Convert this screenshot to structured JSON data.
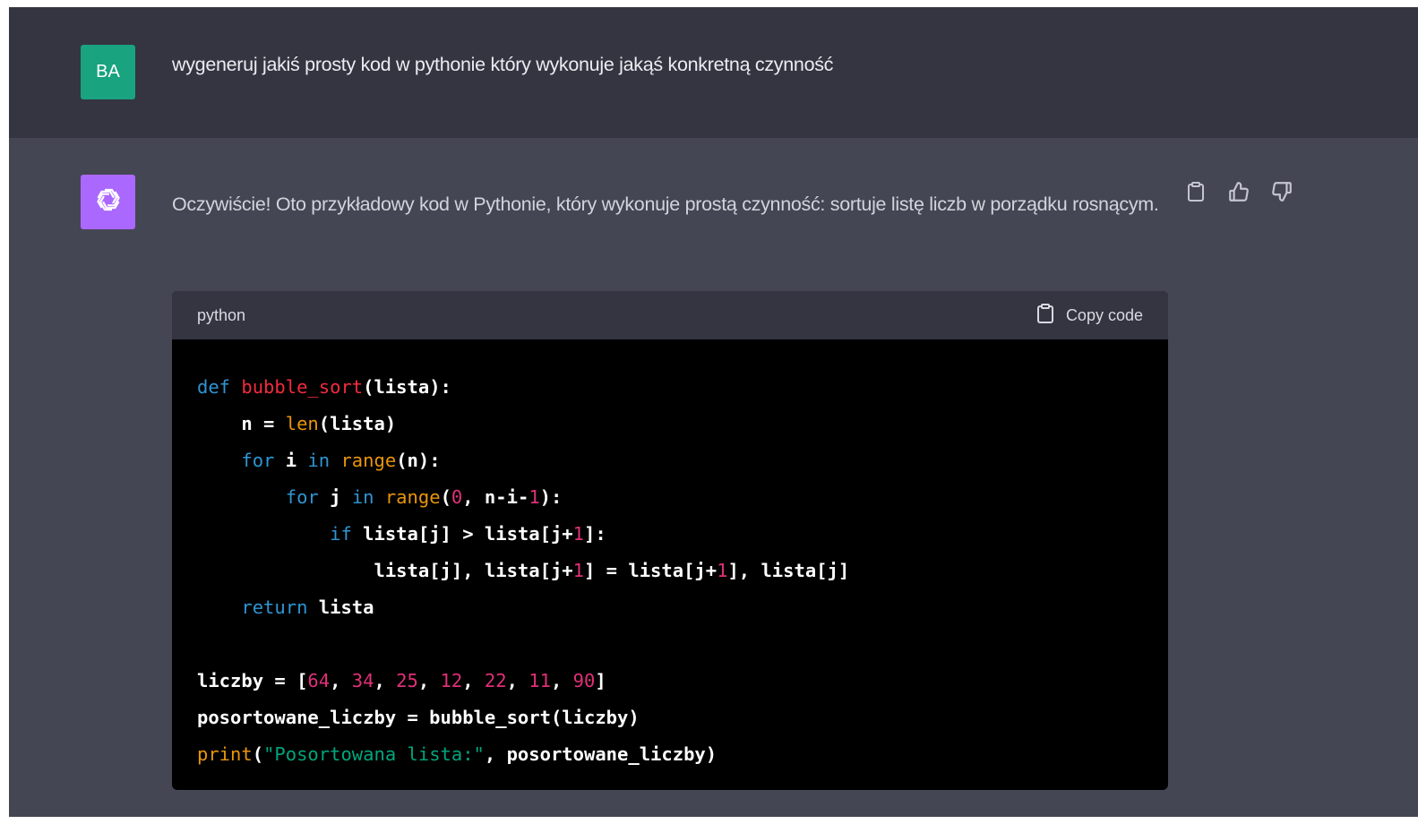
{
  "user_message": {
    "avatar_initials": "BA",
    "text": "wygeneruj jakiś prosty kod w pythonie który wykonuje jakąś konkretną czynność"
  },
  "assistant_message": {
    "avatar_icon": "openai-logo-icon",
    "intro_text": "Oczywiście! Oto przykładowy kod w Pythonie, który wykonuje prostą czynność: sortuje listę liczb w porządku rosnącym.",
    "feedback_icons": [
      "clipboard-icon",
      "thumbs-up-icon",
      "thumbs-down-icon"
    ],
    "code_block": {
      "language": "python",
      "copy_label": "Copy code",
      "lines": [
        [
          {
            "t": "def",
            "c": "keyword"
          },
          {
            "t": " ",
            "c": "plain"
          },
          {
            "t": "bubble_sort",
            "c": "title"
          },
          {
            "t": "(lista):",
            "c": "plain"
          }
        ],
        [
          {
            "t": "    n = ",
            "c": "plain"
          },
          {
            "t": "len",
            "c": "builtin"
          },
          {
            "t": "(lista)",
            "c": "plain"
          }
        ],
        [
          {
            "t": "    ",
            "c": "plain"
          },
          {
            "t": "for",
            "c": "keyword"
          },
          {
            "t": " i ",
            "c": "plain"
          },
          {
            "t": "in",
            "c": "keyword"
          },
          {
            "t": " ",
            "c": "plain"
          },
          {
            "t": "range",
            "c": "builtin"
          },
          {
            "t": "(n):",
            "c": "plain"
          }
        ],
        [
          {
            "t": "        ",
            "c": "plain"
          },
          {
            "t": "for",
            "c": "keyword"
          },
          {
            "t": " j ",
            "c": "plain"
          },
          {
            "t": "in",
            "c": "keyword"
          },
          {
            "t": " ",
            "c": "plain"
          },
          {
            "t": "range",
            "c": "builtin"
          },
          {
            "t": "(",
            "c": "plain"
          },
          {
            "t": "0",
            "c": "number"
          },
          {
            "t": ", n-i-",
            "c": "plain"
          },
          {
            "t": "1",
            "c": "number"
          },
          {
            "t": "):",
            "c": "plain"
          }
        ],
        [
          {
            "t": "            ",
            "c": "plain"
          },
          {
            "t": "if",
            "c": "keyword"
          },
          {
            "t": " lista[j] > lista[j+",
            "c": "plain"
          },
          {
            "t": "1",
            "c": "number"
          },
          {
            "t": "]:",
            "c": "plain"
          }
        ],
        [
          {
            "t": "                lista[j], lista[j+",
            "c": "plain"
          },
          {
            "t": "1",
            "c": "number"
          },
          {
            "t": "] = lista[j+",
            "c": "plain"
          },
          {
            "t": "1",
            "c": "number"
          },
          {
            "t": "], lista[j]",
            "c": "plain"
          }
        ],
        [
          {
            "t": "    ",
            "c": "plain"
          },
          {
            "t": "return",
            "c": "keyword"
          },
          {
            "t": " lista",
            "c": "plain"
          }
        ],
        [],
        [
          {
            "t": "liczby = [",
            "c": "plain"
          },
          {
            "t": "64",
            "c": "number"
          },
          {
            "t": ", ",
            "c": "plain"
          },
          {
            "t": "34",
            "c": "number"
          },
          {
            "t": ", ",
            "c": "plain"
          },
          {
            "t": "25",
            "c": "number"
          },
          {
            "t": ", ",
            "c": "plain"
          },
          {
            "t": "12",
            "c": "number"
          },
          {
            "t": ", ",
            "c": "plain"
          },
          {
            "t": "22",
            "c": "number"
          },
          {
            "t": ", ",
            "c": "plain"
          },
          {
            "t": "11",
            "c": "number"
          },
          {
            "t": ", ",
            "c": "plain"
          },
          {
            "t": "90",
            "c": "number"
          },
          {
            "t": "]",
            "c": "plain"
          }
        ],
        [
          {
            "t": "posortowane_liczby = bubble_sort(liczby)",
            "c": "plain"
          }
        ],
        [
          {
            "t": "print",
            "c": "builtin"
          },
          {
            "t": "(",
            "c": "plain"
          },
          {
            "t": "\"Posortowana lista:\"",
            "c": "string"
          },
          {
            "t": ", posortowane_liczby)",
            "c": "plain"
          }
        ]
      ]
    }
  }
}
